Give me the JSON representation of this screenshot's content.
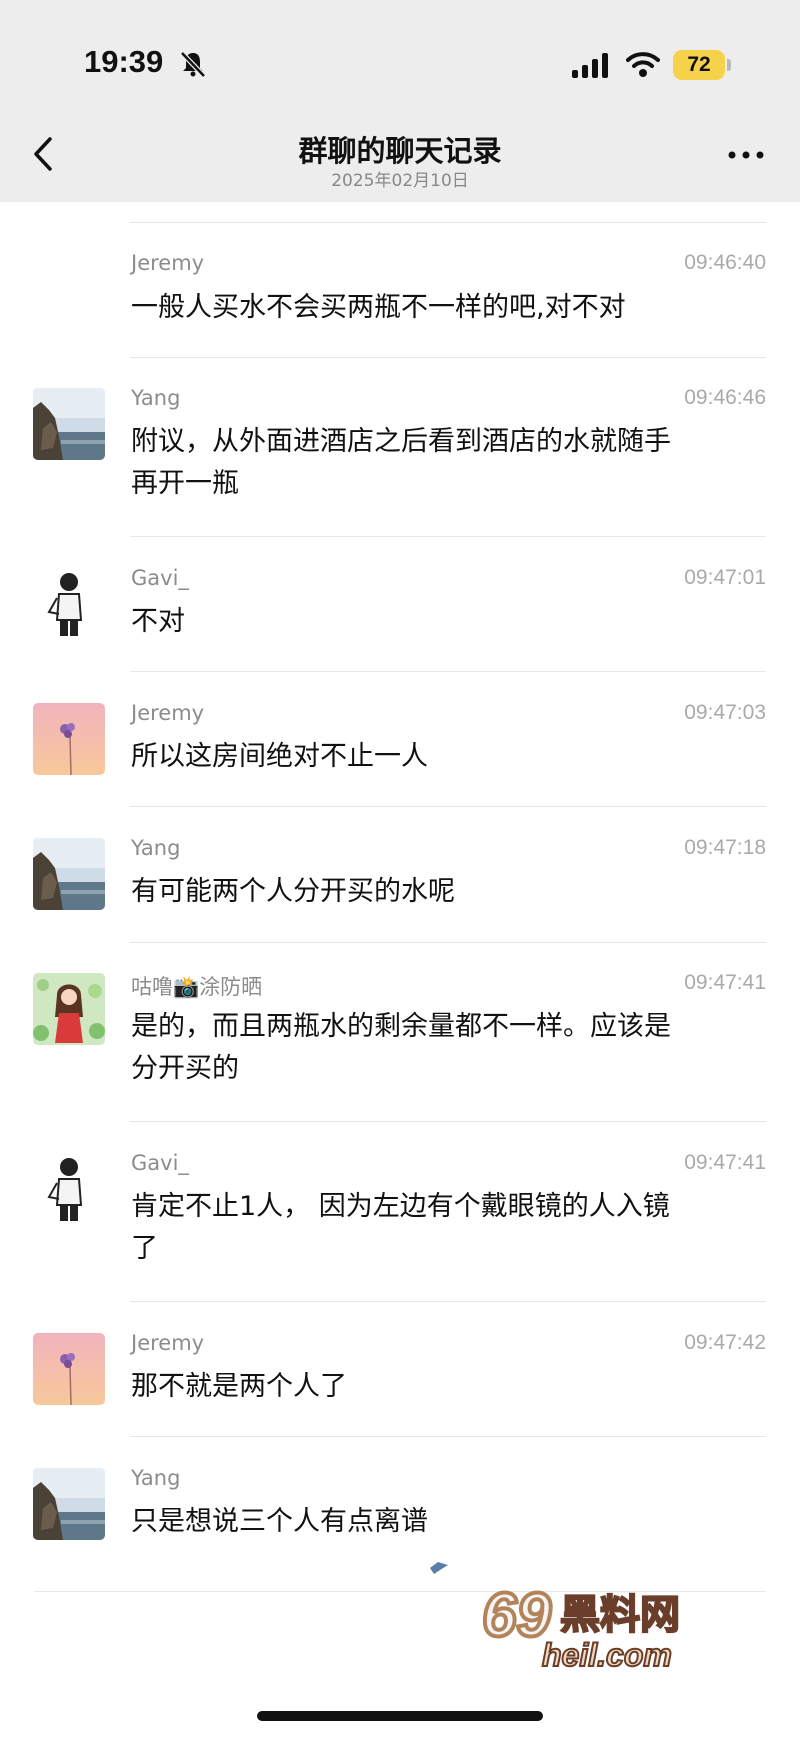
{
  "status_bar": {
    "time": "19:39",
    "battery": "72"
  },
  "nav": {
    "title": "群聊的聊天记录",
    "date": "2025年02月10日"
  },
  "messages": [
    {
      "sender": "Jeremy",
      "time": "09:46:40",
      "lines": [
        "一般人买水不会买两瓶不一样的吧,对不对"
      ],
      "avatar": "none"
    },
    {
      "sender": "Yang",
      "time": "09:46:46",
      "lines": [
        "附议，从外面进酒店之后看到酒店的水就随手",
        "再开一瓶"
      ],
      "avatar": "coast"
    },
    {
      "sender": "Gavi_",
      "time": "09:47:01",
      "lines": [
        "不对"
      ],
      "avatar": "sketch"
    },
    {
      "sender": "Jeremy",
      "time": "09:47:03",
      "lines": [
        "所以这房间绝对不止一人"
      ],
      "avatar": "flower"
    },
    {
      "sender": "Yang",
      "time": "09:47:18",
      "lines": [
        "有可能两个人分开买的水呢"
      ],
      "avatar": "coast"
    },
    {
      "sender": "咕噜📸涂防晒",
      "time": "09:47:41",
      "lines": [
        "是的，而且两瓶水的剩余量都不一样。应该是",
        "分开买的"
      ],
      "avatar": "cartoon"
    },
    {
      "sender": "Gavi_",
      "time": "09:47:41",
      "lines": [
        "肯定不止1人， 因为左边有个戴眼镜的人入镜",
        "了"
      ],
      "avatar": "sketch"
    },
    {
      "sender": "Jeremy",
      "time": "09:47:42",
      "lines": [
        "那不就是两个人了"
      ],
      "avatar": "flower"
    },
    {
      "sender": "Yang",
      "time": "",
      "lines": [
        "只是想说三个人有点离谱"
      ],
      "avatar": "coast"
    }
  ],
  "watermark": {
    "text_top": "69黑料网",
    "text_bottom": "heil.com"
  },
  "colors": {
    "header_bg": "#ededed",
    "battery": "#f6d24a",
    "time_gray": "#a9a9a9"
  }
}
